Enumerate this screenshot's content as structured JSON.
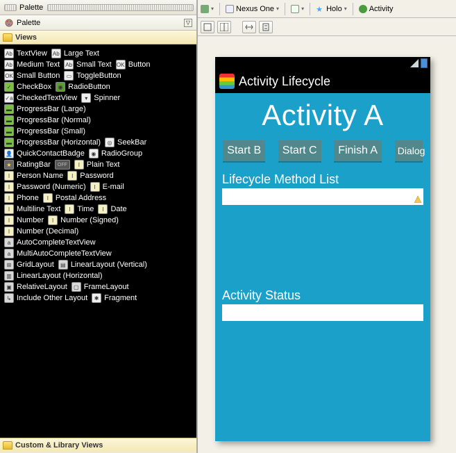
{
  "palette": {
    "header": "Palette",
    "sub_label": "Palette",
    "views_header": "Views",
    "custom_header": "Custom & Library Views",
    "items": {
      "textview": "TextView",
      "large_text": "Large Text",
      "medium_text": "Medium Text",
      "small_text": "Small Text",
      "button": "Button",
      "small_button": "Small Button",
      "toggle_button": "ToggleButton",
      "checkbox": "CheckBox",
      "radio_button": "RadioButton",
      "checked_textview": "CheckedTextView",
      "spinner": "Spinner",
      "progress_large": "ProgressBar (Large)",
      "progress_normal": "ProgressBar (Normal)",
      "progress_small": "ProgressBar (Small)",
      "progress_horizontal": "ProgressBar (Horizontal)",
      "seekbar": "SeekBar",
      "quick_contact": "QuickContactBadge",
      "radio_group": "RadioGroup",
      "rating_bar": "RatingBar",
      "off": "OFF",
      "plain_text": "Plain Text",
      "person_name": "Person Name",
      "password": "Password",
      "password_numeric": "Password (Numeric)",
      "email": "E-mail",
      "phone": "Phone",
      "postal": "Postal Address",
      "multiline": "Multiline Text",
      "time": "Time",
      "date": "Date",
      "number": "Number",
      "number_signed": "Number (Signed)",
      "number_decimal": "Number (Decimal)",
      "autocomplete": "AutoCompleteTextView",
      "multiauto": "MultiAutoCompleteTextView",
      "gridlayout": "GridLayout",
      "linear_v": "LinearLayout (Vertical)",
      "linear_h": "LinearLayout (Horizontal)",
      "relative": "RelativeLayout",
      "frame": "FrameLayout",
      "include": "Include Other Layout",
      "fragment": "Fragment"
    }
  },
  "toolbar": {
    "device": "Nexus One",
    "theme": "Holo",
    "activity": "Activity"
  },
  "device_preview": {
    "app_title": "Activity Lifecycle",
    "screen_title": "Activity A",
    "buttons": {
      "start_b": "Start B",
      "start_c": "Start C",
      "finish_a": "Finish A",
      "dialog": "Dialog"
    },
    "section_lifecycle": "Lifecycle Method List",
    "section_status": "Activity Status"
  },
  "colors": {
    "device_bg": "#1ba1c9",
    "holo_btn": "#50888b"
  }
}
